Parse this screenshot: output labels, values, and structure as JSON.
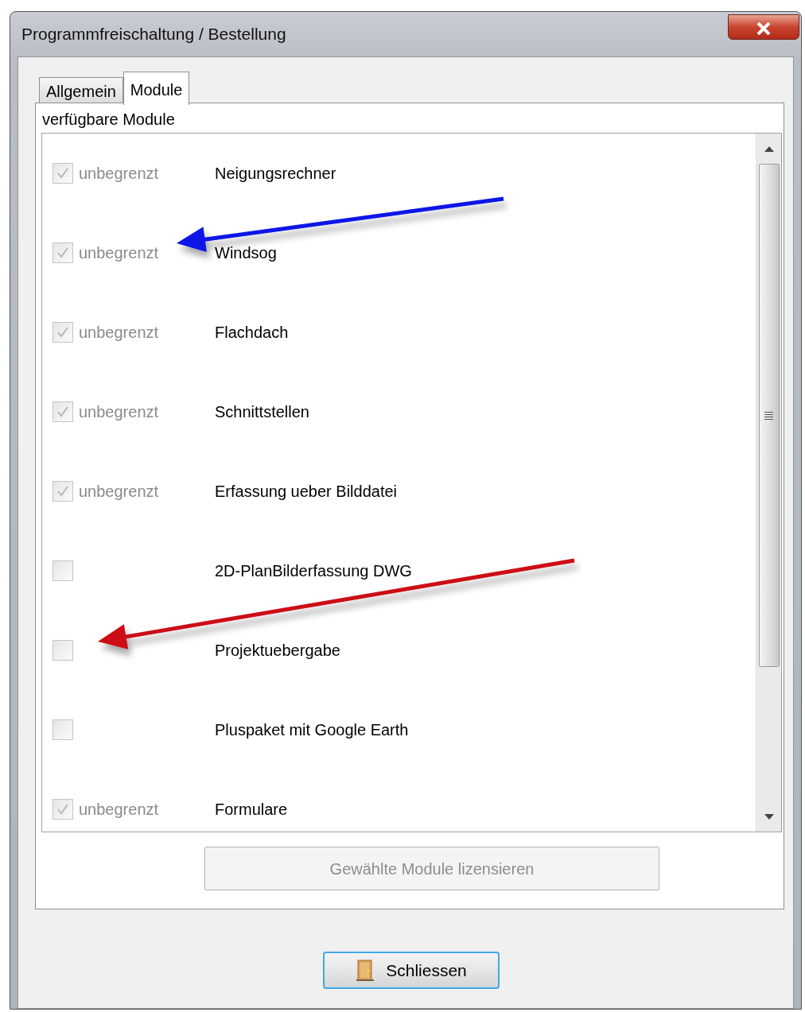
{
  "window": {
    "title": "Programmfreischaltung / Bestellung"
  },
  "tabs": [
    {
      "label": "Allgemein",
      "selected": false
    },
    {
      "label": "Module",
      "selected": true
    }
  ],
  "group": {
    "label": "verfügbare Module"
  },
  "modules": [
    {
      "checked": true,
      "status": "unbegrenzt",
      "name": "Neigungsrechner"
    },
    {
      "checked": true,
      "status": "unbegrenzt",
      "name": "Windsog"
    },
    {
      "checked": true,
      "status": "unbegrenzt",
      "name": "Flachdach"
    },
    {
      "checked": true,
      "status": "unbegrenzt",
      "name": "Schnittstellen"
    },
    {
      "checked": true,
      "status": "unbegrenzt",
      "name": "Erfassung ueber Bilddatei"
    },
    {
      "checked": false,
      "name": "2D-PlanBilderfassung DWG"
    },
    {
      "checked": false,
      "name": "Projektuebergabe"
    },
    {
      "checked": false,
      "name": "Pluspaket mit Google Earth"
    },
    {
      "checked": true,
      "status": "unbegrenzt",
      "name": "Formulare"
    }
  ],
  "license_button": {
    "label": "Gewählte Module lizensieren",
    "disabled": true
  },
  "close_button": {
    "label": "Schliessen"
  },
  "annotations": [
    {
      "color": "#0a14e6"
    },
    {
      "color": "#cc0a12"
    }
  ]
}
